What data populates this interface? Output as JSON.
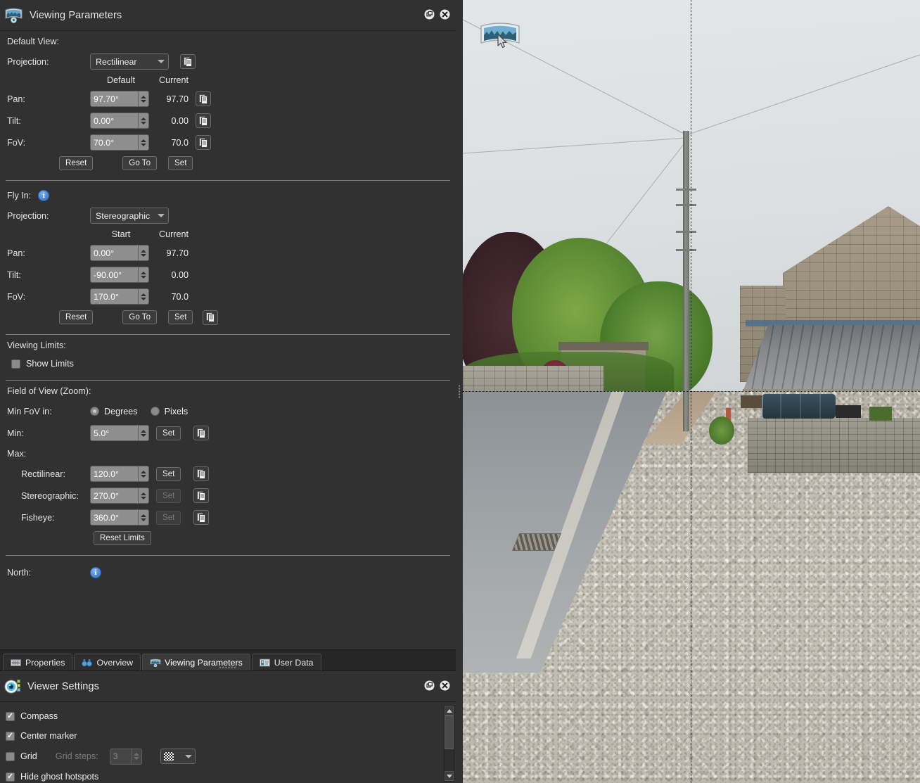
{
  "viewing_parameters_panel": {
    "title": "Viewing Parameters",
    "icon": "panorama-icon",
    "header_buttons": [
      {
        "name": "float-panel-button",
        "label": "Float"
      },
      {
        "name": "close-panel-button",
        "label": "Close"
      }
    ],
    "default_view": {
      "section_label": "Default View:",
      "projection_label": "Projection:",
      "projection_value": "Rectilinear",
      "column_headers": {
        "first": "Default",
        "second": "Current"
      },
      "rows": [
        {
          "label": "Pan:",
          "value": "97.70°",
          "current": "97.70"
        },
        {
          "label": "Tilt:",
          "value": "0.00°",
          "current": "0.00"
        },
        {
          "label": "FoV:",
          "value": "70.0°",
          "current": "70.0"
        }
      ],
      "buttons": {
        "reset": "Reset",
        "goto": "Go To",
        "set": "Set"
      }
    },
    "fly_in": {
      "section_label": "Fly In:",
      "projection_label": "Projection:",
      "projection_value": "Stereographic",
      "column_headers": {
        "first": "Start",
        "second": "Current"
      },
      "rows": [
        {
          "label": "Pan:",
          "value": "0.00°",
          "current": "97.70"
        },
        {
          "label": "Tilt:",
          "value": "-90.00°",
          "current": "0.00"
        },
        {
          "label": "FoV:",
          "value": "170.0°",
          "current": "70.0"
        }
      ],
      "buttons": {
        "reset": "Reset",
        "goto": "Go To",
        "set": "Set"
      }
    },
    "viewing_limits": {
      "section_label": "Viewing Limits:",
      "show_limits_label": "Show Limits",
      "show_limits_checked": false
    },
    "field_of_view": {
      "section_label": "Field of View (Zoom):",
      "min_fov_in_label": "Min FoV in:",
      "unit_options": [
        {
          "label": "Degrees",
          "selected": true
        },
        {
          "label": "Pixels",
          "selected": false
        }
      ],
      "min_label": "Min:",
      "min_value": "5.0°",
      "min_set_button": "Set",
      "max_label": "Max:",
      "max_rows": [
        {
          "label": "Rectilinear:",
          "value": "120.0°",
          "set_button": "Set",
          "set_enabled": true
        },
        {
          "label": "Stereographic:",
          "value": "270.0°",
          "set_button": "Set",
          "set_enabled": false
        },
        {
          "label": "Fisheye:",
          "value": "360.0°",
          "set_button": "Set",
          "set_enabled": false
        }
      ],
      "reset_limits_button": "Reset Limits"
    },
    "north": {
      "section_label": "North:"
    },
    "tabs": [
      {
        "label": "Properties",
        "icon": "properties-icon",
        "active": false
      },
      {
        "label": "Overview",
        "icon": "binoculars-icon",
        "active": false
      },
      {
        "label": "Viewing Parameters",
        "icon": "panorama-icon",
        "active": true
      },
      {
        "label": "User Data",
        "icon": "user-data-icon",
        "active": false
      }
    ]
  },
  "viewer_settings_panel": {
    "title": "Viewer Settings",
    "icon": "eye-icon",
    "header_buttons": [
      {
        "name": "float-panel-button",
        "label": "Float"
      },
      {
        "name": "close-panel-button",
        "label": "Close"
      }
    ],
    "items": [
      {
        "label": "Compass",
        "checked": true,
        "enabled": true
      },
      {
        "label": "Center marker",
        "checked": true,
        "enabled": true
      },
      {
        "label": "Grid",
        "checked": false,
        "enabled": true,
        "grid_steps_label": "Grid steps:",
        "grid_steps_value": "3",
        "grid_style": "checker-pattern"
      },
      {
        "label": "Hide ghost hotspots",
        "checked": true,
        "enabled": true
      }
    ]
  },
  "panorama_view": {
    "name": "panorama-viewport",
    "hotspot": "panorama-hotspot-icon",
    "cursor": "mouse-cursor",
    "center_marker_visible": true
  },
  "colors": {
    "panel_bg": "#313131",
    "panel_header_bg": "#313131",
    "text": "#e8e8e8",
    "field_bg": "#8e8e8e",
    "accent_info": "#3f7fd0",
    "tab_active_bg": "#3a3a3a"
  }
}
